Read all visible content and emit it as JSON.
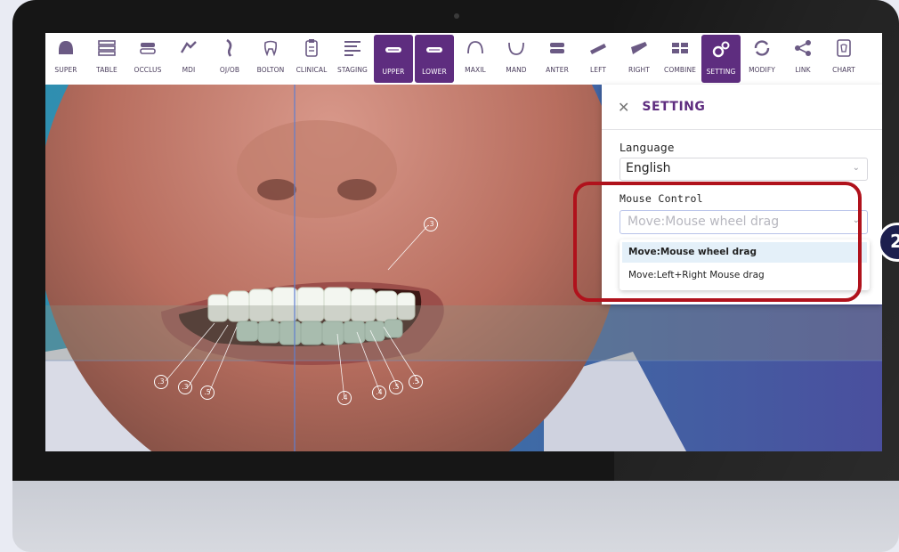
{
  "toolbar": {
    "items": [
      {
        "label": "SUPER",
        "icon": "super-icon",
        "active": false
      },
      {
        "label": "TABLE",
        "icon": "table-icon",
        "active": false
      },
      {
        "label": "OCCLUS",
        "icon": "occlusion-icon",
        "active": false
      },
      {
        "label": "MDI",
        "icon": "mdi-icon",
        "active": false
      },
      {
        "label": "OJ/OB",
        "icon": "ojob-icon",
        "active": false
      },
      {
        "label": "BOLTON",
        "icon": "tooth-icon",
        "active": false
      },
      {
        "label": "CLINICAL",
        "icon": "clipboard-icon",
        "active": false
      },
      {
        "label": "STAGING",
        "icon": "staging-icon",
        "active": false
      },
      {
        "label": "UPPER",
        "icon": "upper-arch-icon",
        "active": true
      },
      {
        "label": "LOWER",
        "icon": "lower-arch-icon",
        "active": true
      },
      {
        "label": "MAXIL",
        "icon": "maxilla-icon",
        "active": false
      },
      {
        "label": "MAND",
        "icon": "mandible-icon",
        "active": false
      },
      {
        "label": "ANTER",
        "icon": "anterior-icon",
        "active": false
      },
      {
        "label": "LEFT",
        "icon": "left-view-icon",
        "active": false
      },
      {
        "label": "RIGHT",
        "icon": "right-view-icon",
        "active": false
      },
      {
        "label": "COMBINE",
        "icon": "combine-icon",
        "active": false
      },
      {
        "label": "SETTING",
        "icon": "gears-icon",
        "active": true
      },
      {
        "label": "MODIFY",
        "icon": "refresh-icon",
        "active": false
      },
      {
        "label": "LINK",
        "icon": "share-icon",
        "active": false
      },
      {
        "label": "CHART",
        "icon": "chart-tooth-icon",
        "active": false
      }
    ]
  },
  "panel": {
    "title": "SETTING",
    "close_icon": "close-icon",
    "language": {
      "label": "Language",
      "value": "English"
    },
    "mouse_control": {
      "label": "Mouse Control",
      "placeholder": "Move:Mouse wheel drag",
      "options": [
        "Move:Mouse wheel drag",
        "Move:Left+Right Mouse drag"
      ],
      "selected_index": 0
    }
  },
  "annotations": {
    "upper": [
      ".3"
    ],
    "lower_left": [
      ".3",
      ".3",
      ".5"
    ],
    "lower_right": [
      ".4",
      ".4",
      ".5",
      ".5"
    ]
  },
  "step_badge": "2",
  "colors": {
    "accent": "#5e2d7f",
    "highlight": "#b0121c",
    "badge": "#1d1f4e",
    "option_selected_bg": "#e4f0f9"
  }
}
